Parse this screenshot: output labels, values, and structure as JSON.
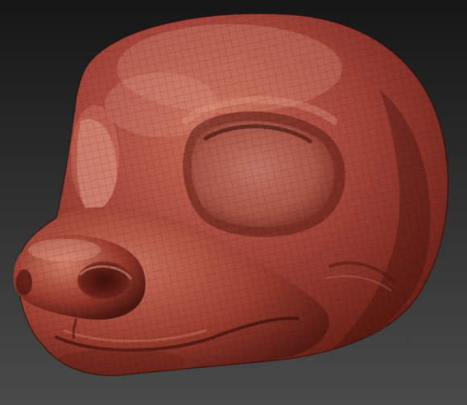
{
  "scene": {
    "background_top": "#161616",
    "background_bottom": "#4a4a4a",
    "clay_color": "#9b3d2f",
    "clay_highlight": "#d48a74",
    "clay_shadow": "#3a100b",
    "mesh_visible": true,
    "subject": "sculpted-animal-head"
  }
}
